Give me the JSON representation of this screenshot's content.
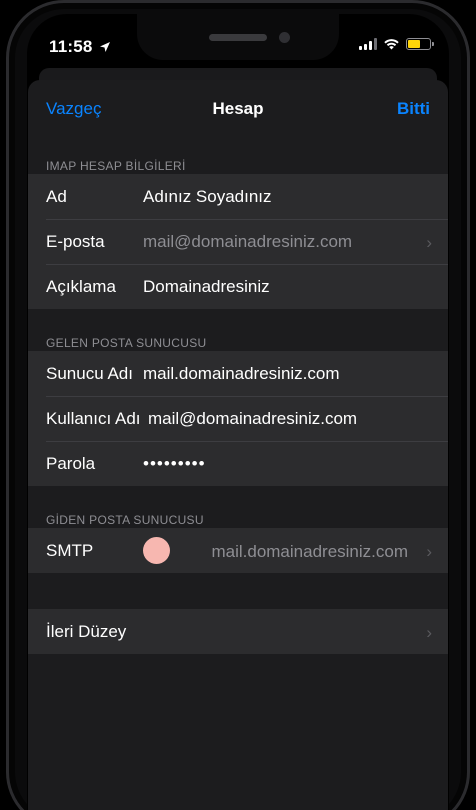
{
  "status": {
    "time": "11:58",
    "location_icon": "location-arrow-icon",
    "battery_color": "#ffd60a"
  },
  "nav": {
    "cancel": "Vazgeç",
    "title": "Hesap",
    "done": "Bitti",
    "accent": "#0a84ff"
  },
  "imap": {
    "header": "IMAP HESAP BİLGİLERİ",
    "name_label": "Ad",
    "name_value": "Adınız Soyadınız",
    "email_label": "E-posta",
    "email_value": "mail@domainadresiniz.com",
    "desc_label": "Açıklama",
    "desc_value": "Domainadresiniz"
  },
  "incoming": {
    "header": "GELEN POSTA SUNUCUSU",
    "server_label": "Sunucu Adı",
    "server_value": "mail.domainadresiniz.com",
    "user_label": "Kullanıcı Adı",
    "user_value": "mail@domainadresiniz.com",
    "password_label": "Parola",
    "password_value": "•••••••••"
  },
  "outgoing": {
    "header": "GİDEN POSTA SUNUCUSU",
    "smtp_label": "SMTP",
    "smtp_value": "mail.domainadresiniz.com"
  },
  "advanced": {
    "label": "İleri Düzey"
  }
}
